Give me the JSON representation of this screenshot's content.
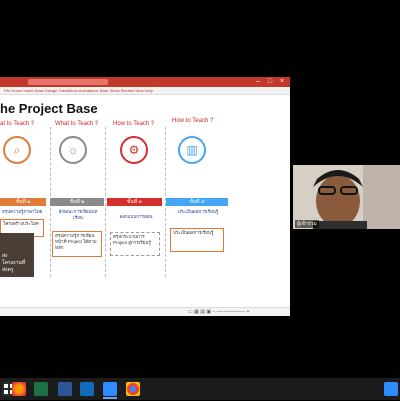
{
  "window": {
    "search_placeholder": "Search",
    "ribbon_tabs": "File   Home   Insert   Draw   Design   Transitions   Animations   Slide Show   Review   View   Help"
  },
  "slide": {
    "title": "he Project Base",
    "questions": [
      "at to Teach ?",
      "What to Teach ?",
      "How to Teach ?",
      "How to Teach ?"
    ],
    "stage_labels": [
      "ขั้นที่ ๑",
      "ขั้นที่ ๒",
      "ขั้นที่ ๓",
      "ขั้นที่ ๔"
    ],
    "col1_text": "สรุปความรู้ภาษาไทย",
    "col1_box": "โครงสร้างประโยค",
    "col2_text": "ลักษณะการเขียนบทเรียน",
    "col2_box": "สรุปความรู้การเขียนหน้าที่ Project ได้ตามหลัก",
    "col3_text": "ออกแบบการสอน",
    "col3_box": "สรุปกระบวนการ Project สู่การเรียนรู้",
    "col4_text": "ประเมินผลการเรียนรู้",
    "col4_box": "ประเมินผลการเรียนรู้",
    "dark_card_text": [
      "ส่ง",
      "โครงงานที่",
      "ส่งครู"
    ]
  },
  "statusbar": {
    "icons": "▭  ▦  ▤  ▣   −  ────────  +"
  },
  "webcam": {
    "participant_label": "ผู้เข้าร่วม"
  },
  "colors": {
    "ppt_red": "#c0392b",
    "stage1": "#e07b39",
    "stage2": "#8a8a8a",
    "stage3": "#d32f2f",
    "stage4": "#42a5f5"
  },
  "taskbar": {
    "icons": [
      "start-icon",
      "firefox-icon",
      "excel-icon",
      "word-icon",
      "edge-icon",
      "zoom-icon",
      "chrome-icon",
      "tray-icon"
    ]
  }
}
